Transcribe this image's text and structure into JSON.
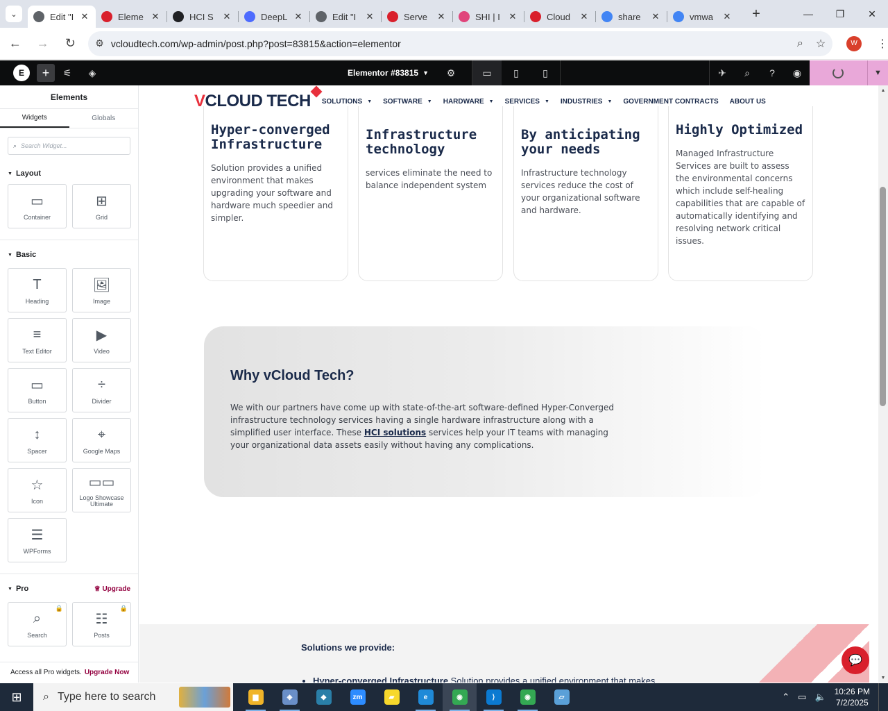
{
  "browser": {
    "tabs": [
      {
        "title": "Edit \"I",
        "active": true,
        "fav_color": "#5f6368"
      },
      {
        "title": "Eleme",
        "active": false,
        "fav_color": "#d9202c"
      },
      {
        "title": "HCI S",
        "active": false,
        "fav_color": "#202124"
      },
      {
        "title": "DeepL",
        "active": false,
        "fav_color": "#4d6bfe"
      },
      {
        "title": "Edit \"I",
        "active": false,
        "fav_color": "#5f6368"
      },
      {
        "title": "Serve",
        "active": false,
        "fav_color": "#d9202c"
      },
      {
        "title": "SHI | I",
        "active": false,
        "fav_color": "#e0457b"
      },
      {
        "title": "Cloud",
        "active": false,
        "fav_color": "#d9202c"
      },
      {
        "title": "share",
        "active": false,
        "fav_color": "#4285f4"
      },
      {
        "title": "vmwa",
        "active": false,
        "fav_color": "#4285f4"
      }
    ],
    "url": "vcloudtech.com/wp-admin/post.php?post=83815&action=elementor",
    "profile_initial": "W"
  },
  "elementor": {
    "document_title": "Elementor #83815",
    "panel": {
      "title": "Elements",
      "tabs": [
        "Widgets",
        "Globals"
      ],
      "search_placeholder": "Search Widget...",
      "categories": {
        "layout": {
          "label": "Layout",
          "widgets": [
            {
              "label": "Container",
              "icon": "▭"
            },
            {
              "label": "Grid",
              "icon": "⊞"
            }
          ]
        },
        "basic": {
          "label": "Basic",
          "widgets": [
            {
              "label": "Heading",
              "icon": "T"
            },
            {
              "label": "Image",
              "icon": "🖼"
            },
            {
              "label": "Text Editor",
              "icon": "≡"
            },
            {
              "label": "Video",
              "icon": "▶"
            },
            {
              "label": "Button",
              "icon": "▭"
            },
            {
              "label": "Divider",
              "icon": "÷"
            },
            {
              "label": "Spacer",
              "icon": "↕"
            },
            {
              "label": "Google Maps",
              "icon": "⌖"
            },
            {
              "label": "Icon",
              "icon": "☆"
            },
            {
              "label": "Logo Showcase Ultimate",
              "icon": "▭▭"
            },
            {
              "label": "WPForms",
              "icon": "☰"
            }
          ]
        },
        "pro": {
          "label": "Pro",
          "upgrade_label": "Upgrade",
          "widgets": [
            {
              "label": "Search",
              "icon": "⌕"
            },
            {
              "label": "Posts",
              "icon": "☷"
            }
          ]
        }
      },
      "footer_text": "Access all Pro widgets.",
      "footer_link": "Upgrade Now"
    }
  },
  "site": {
    "logo_v": "V",
    "logo_rest": "CLOUD TECH",
    "nav": [
      {
        "label": "SOLUTIONS",
        "dropdown": true
      },
      {
        "label": "SOFTWARE",
        "dropdown": true
      },
      {
        "label": "HARDWARE",
        "dropdown": true
      },
      {
        "label": "SERVICES",
        "dropdown": true
      },
      {
        "label": "INDUSTRIES",
        "dropdown": true
      },
      {
        "label": "GOVERNMENT CONTRACTS",
        "dropdown": false
      },
      {
        "label": "ABOUT US",
        "dropdown": false
      }
    ],
    "cards": [
      {
        "title": "Hyper-converged Infrastructure",
        "text": "Solution provides a unified environment that makes upgrading your software and hardware much speedier and simpler."
      },
      {
        "title": "Infrastructure technology",
        "text": "services eliminate the need to balance independent system"
      },
      {
        "title": "By anticipating your needs",
        "text": "Infrastructure technology services reduce the cost of your organizational software and hardware."
      },
      {
        "title": "Highly Optimized",
        "text": "Managed Infrastructure Services are built to assess the environmental concerns which include self-healing capabilities that are capable of automatically identifying and resolving network critical issues."
      }
    ],
    "why": {
      "heading": "Why vCloud Tech?",
      "text_before": "We with our partners have come up with state-of-the-art software-defined Hyper-Converged infrastructure technology services having a single hardware infrastructure along with a simplified user interface. These ",
      "link": "HCI solutions",
      "text_after": " services help your IT teams with managing your organizational data assets easily without having any complications."
    },
    "solutions": {
      "heading": "Solutions we provide:",
      "first_item_bold": "Hyper-converged Infrastructure",
      "first_item_text": " Solution provides a unified environment that makes"
    }
  },
  "taskbar": {
    "search_placeholder": "Type here to search",
    "time": "10:26 PM",
    "date": "7/2/2025",
    "apps": [
      {
        "name": "file-explorer",
        "color": "#f0b429",
        "glyph": "▆"
      },
      {
        "name": "app-2",
        "color": "#6a8fc8",
        "glyph": "◈"
      },
      {
        "name": "app-3",
        "color": "#2a7fa8",
        "glyph": "◆"
      },
      {
        "name": "zoom",
        "color": "#2d8cff",
        "glyph": "zm"
      },
      {
        "name": "sticky-notes",
        "color": "#f7d82c",
        "glyph": "▰"
      },
      {
        "name": "edge",
        "color": "#1f8ad8",
        "glyph": "e"
      },
      {
        "name": "chrome",
        "color": "#34a853",
        "glyph": "◉"
      },
      {
        "name": "vscode",
        "color": "#0b7ad1",
        "glyph": "⟩"
      },
      {
        "name": "chrome-2",
        "color": "#34a853",
        "glyph": "◉"
      },
      {
        "name": "app-10",
        "color": "#5aa0d8",
        "glyph": "▱"
      }
    ]
  }
}
